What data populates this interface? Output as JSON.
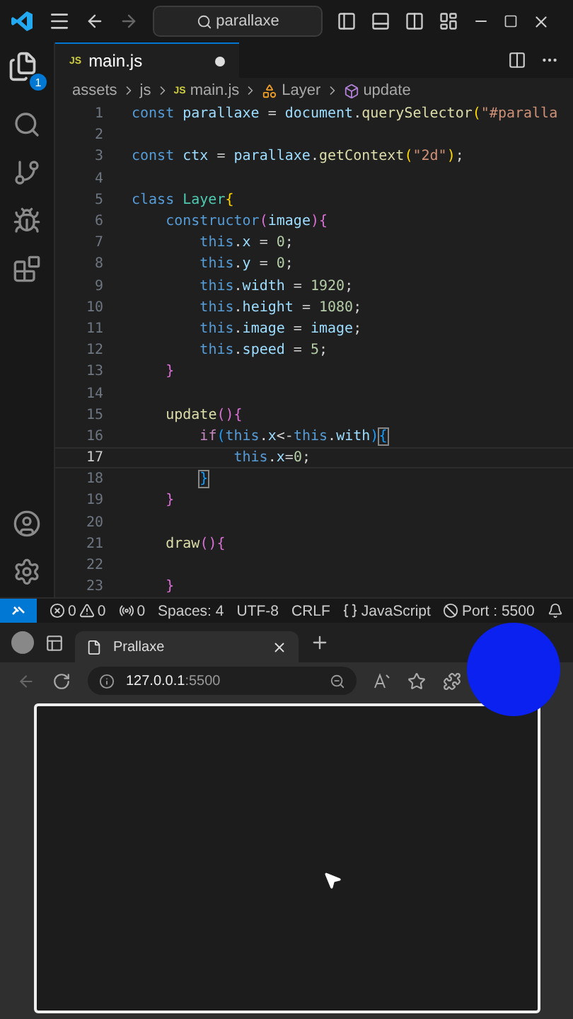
{
  "title_bar": {
    "search": "parallaxe"
  },
  "explorer_badge": "1",
  "editor_tab": {
    "file_badge": "JS",
    "label": "main.js",
    "dirty": true,
    "selected": true
  },
  "breadcrumb": [
    {
      "label": "assets",
      "kind": "text"
    },
    {
      "label": "js",
      "kind": "text"
    },
    {
      "label": "main.js",
      "kind": "file",
      "badge": "JS"
    },
    {
      "label": "Layer",
      "kind": "class"
    },
    {
      "label": "update",
      "kind": "method"
    }
  ],
  "code_lines": [
    {
      "number": "1",
      "active": false,
      "tokens": [
        {
          "t": "const ",
          "color": "#569cd6"
        },
        {
          "t": "parallaxe ",
          "color": "#9cdcfe"
        },
        {
          "t": "= ",
          "color": "#d4d4d4"
        },
        {
          "t": "document",
          "color": "#9cdcfe"
        },
        {
          "t": ".",
          "color": "#d4d4d4"
        },
        {
          "t": "querySelector",
          "color": "#dcdcaa"
        },
        {
          "t": "(",
          "color": "#ffd700"
        },
        {
          "t": "\"#paralla",
          "color": "#ce9178"
        }
      ]
    },
    {
      "number": "2",
      "active": false
    },
    {
      "number": "3",
      "active": false,
      "tokens": [
        {
          "t": "const ",
          "color": "#569cd6"
        },
        {
          "t": "ctx ",
          "color": "#9cdcfe"
        },
        {
          "t": "= ",
          "color": "#d4d4d4"
        },
        {
          "t": "parallaxe",
          "color": "#9cdcfe"
        },
        {
          "t": ".",
          "color": "#d4d4d4"
        },
        {
          "t": "getContext",
          "color": "#dcdcaa"
        },
        {
          "t": "(",
          "color": "#ffd700"
        },
        {
          "t": "\"2d\"",
          "color": "#ce9178"
        },
        {
          "t": ")",
          "color": "#ffd700"
        },
        {
          "t": ";",
          "color": "#d4d4d4"
        }
      ]
    },
    {
      "number": "4",
      "active": false
    },
    {
      "number": "5",
      "active": false,
      "tokens": [
        {
          "t": "class ",
          "color": "#569cd6"
        },
        {
          "t": "Layer",
          "color": "#4ec9b0"
        },
        {
          "t": "{",
          "color": "#ffd700"
        }
      ]
    },
    {
      "number": "6",
      "active": false,
      "tokens": [
        {
          "t": "    constructor",
          "color": "#569cd6"
        },
        {
          "t": "(",
          "color": "#da70d6"
        },
        {
          "t": "image",
          "color": "#9cdcfe"
        },
        {
          "t": "){",
          "color": "#da70d6"
        }
      ]
    },
    {
      "number": "7",
      "active": false,
      "tokens": [
        {
          "t": "        this",
          "color": "#569cd6"
        },
        {
          "t": ".",
          "color": "#d4d4d4"
        },
        {
          "t": "x ",
          "color": "#9cdcfe"
        },
        {
          "t": "= ",
          "color": "#d4d4d4"
        },
        {
          "t": "0",
          "color": "#b5cea8"
        },
        {
          "t": ";",
          "color": "#d4d4d4"
        }
      ]
    },
    {
      "number": "8",
      "active": false,
      "tokens": [
        {
          "t": "        this",
          "color": "#569cd6"
        },
        {
          "t": ".",
          "color": "#d4d4d4"
        },
        {
          "t": "y ",
          "color": "#9cdcfe"
        },
        {
          "t": "= ",
          "color": "#d4d4d4"
        },
        {
          "t": "0",
          "color": "#b5cea8"
        },
        {
          "t": ";",
          "color": "#d4d4d4"
        }
      ]
    },
    {
      "number": "9",
      "active": false,
      "tokens": [
        {
          "t": "        this",
          "color": "#569cd6"
        },
        {
          "t": ".",
          "color": "#d4d4d4"
        },
        {
          "t": "width ",
          "color": "#9cdcfe"
        },
        {
          "t": "= ",
          "color": "#d4d4d4"
        },
        {
          "t": "1920",
          "color": "#b5cea8"
        },
        {
          "t": ";",
          "color": "#d4d4d4"
        }
      ]
    },
    {
      "number": "10",
      "active": false,
      "tokens": [
        {
          "t": "        this",
          "color": "#569cd6"
        },
        {
          "t": ".",
          "color": "#d4d4d4"
        },
        {
          "t": "height ",
          "color": "#9cdcfe"
        },
        {
          "t": "= ",
          "color": "#d4d4d4"
        },
        {
          "t": "1080",
          "color": "#b5cea8"
        },
        {
          "t": ";",
          "color": "#d4d4d4"
        }
      ]
    },
    {
      "number": "11",
      "active": false,
      "tokens": [
        {
          "t": "        this",
          "color": "#569cd6"
        },
        {
          "t": ".",
          "color": "#d4d4d4"
        },
        {
          "t": "image ",
          "color": "#9cdcfe"
        },
        {
          "t": "= ",
          "color": "#d4d4d4"
        },
        {
          "t": "image",
          "color": "#9cdcfe"
        },
        {
          "t": ";",
          "color": "#d4d4d4"
        }
      ]
    },
    {
      "number": "12",
      "active": false,
      "tokens": [
        {
          "t": "        this",
          "color": "#569cd6"
        },
        {
          "t": ".",
          "color": "#d4d4d4"
        },
        {
          "t": "speed ",
          "color": "#9cdcfe"
        },
        {
          "t": "= ",
          "color": "#d4d4d4"
        },
        {
          "t": "5",
          "color": "#b5cea8"
        },
        {
          "t": ";",
          "color": "#d4d4d4"
        }
      ]
    },
    {
      "number": "13",
      "active": false,
      "tokens": [
        {
          "t": "    }",
          "color": "#da70d6"
        }
      ]
    },
    {
      "number": "14",
      "active": false
    },
    {
      "number": "15",
      "active": false,
      "tokens": [
        {
          "t": "    update",
          "color": "#dcdcaa"
        },
        {
          "t": "(){",
          "color": "#da70d6"
        }
      ]
    },
    {
      "number": "16",
      "active": false,
      "tokens": [
        {
          "t": "        if",
          "color": "#c586c0"
        },
        {
          "t": "(",
          "color": "#179fff"
        },
        {
          "t": "this",
          "color": "#569cd6"
        },
        {
          "t": ".",
          "color": "#d4d4d4"
        },
        {
          "t": "x",
          "color": "#9cdcfe"
        },
        {
          "t": "<-",
          "color": "#d4d4d4"
        },
        {
          "t": "this",
          "color": "#569cd6"
        },
        {
          "t": ".",
          "color": "#d4d4d4"
        },
        {
          "t": "with",
          "color": "#9cdcfe"
        },
        {
          "t": ")",
          "color": "#179fff"
        },
        {
          "t": "{",
          "color": "#179fff",
          "boxed": true
        }
      ]
    },
    {
      "number": "17",
      "active": true,
      "tokens": [
        {
          "t": "            this",
          "color": "#569cd6"
        },
        {
          "t": ".",
          "color": "#d4d4d4"
        },
        {
          "t": "x",
          "color": "#9cdcfe"
        },
        {
          "t": "=",
          "color": "#d4d4d4"
        },
        {
          "t": "0",
          "color": "#b5cea8"
        },
        {
          "t": ";",
          "color": "#d4d4d4"
        }
      ]
    },
    {
      "number": "18",
      "active": false,
      "tokens": [
        {
          "t": "        }",
          "color": "#179fff",
          "boxed": true
        }
      ]
    },
    {
      "number": "19",
      "active": false,
      "tokens": [
        {
          "t": "    }",
          "color": "#da70d6"
        }
      ]
    },
    {
      "number": "20",
      "active": false
    },
    {
      "number": "21",
      "active": false,
      "tokens": [
        {
          "t": "    draw",
          "color": "#dcdcaa"
        },
        {
          "t": "(){",
          "color": "#da70d6"
        }
      ]
    },
    {
      "number": "22",
      "active": false
    },
    {
      "number": "23",
      "active": false,
      "tokens": [
        {
          "t": "    }",
          "color": "#da70d6"
        }
      ]
    }
  ],
  "status_bar": {
    "errors": "0",
    "warnings": "0",
    "ports": "0",
    "items": [
      "Spaces: 4",
      "UTF-8",
      "CRLF"
    ],
    "language": "JavaScript",
    "live_server": "Port : 5500"
  },
  "browser": {
    "tab": {
      "title": "Prallaxe",
      "selected": true
    },
    "address": "**127.0.0.1**:5500"
  }
}
